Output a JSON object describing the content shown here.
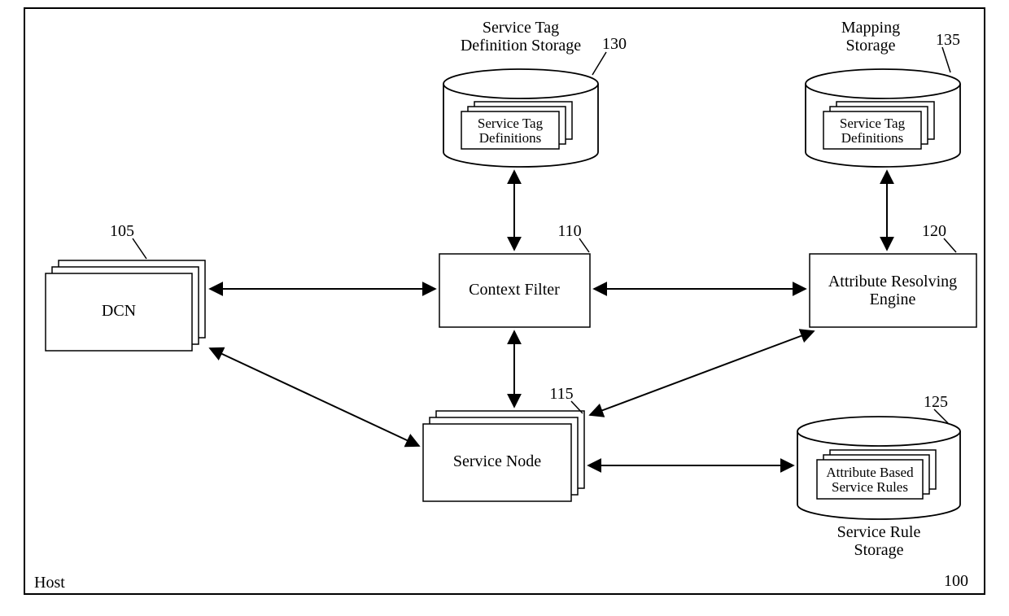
{
  "host": {
    "label": "Host",
    "ref": "100"
  },
  "nodes": {
    "dcn": {
      "label": "DCN",
      "ref": "105"
    },
    "contextFilter": {
      "label": "Context Filter",
      "ref": "110"
    },
    "serviceNode": {
      "label": "Service Node",
      "ref": "115"
    },
    "attrEngine": {
      "label1": "Attribute Resolving",
      "label2": "Engine",
      "ref": "120"
    }
  },
  "storages": {
    "tagDefStorage": {
      "title1": "Service Tag",
      "title2": "Definition Storage",
      "ref": "130",
      "doc1": "Service Tag",
      "doc2": "Definitions"
    },
    "mappingStorage": {
      "title1": "Mapping",
      "title2": "Storage",
      "ref": "135",
      "doc1": "Service Tag",
      "doc2": "Definitions"
    },
    "ruleStorage": {
      "title1": "Service Rule",
      "title2": "Storage",
      "ref": "125",
      "doc1": "Attribute Based",
      "doc2": "Service Rules"
    }
  }
}
